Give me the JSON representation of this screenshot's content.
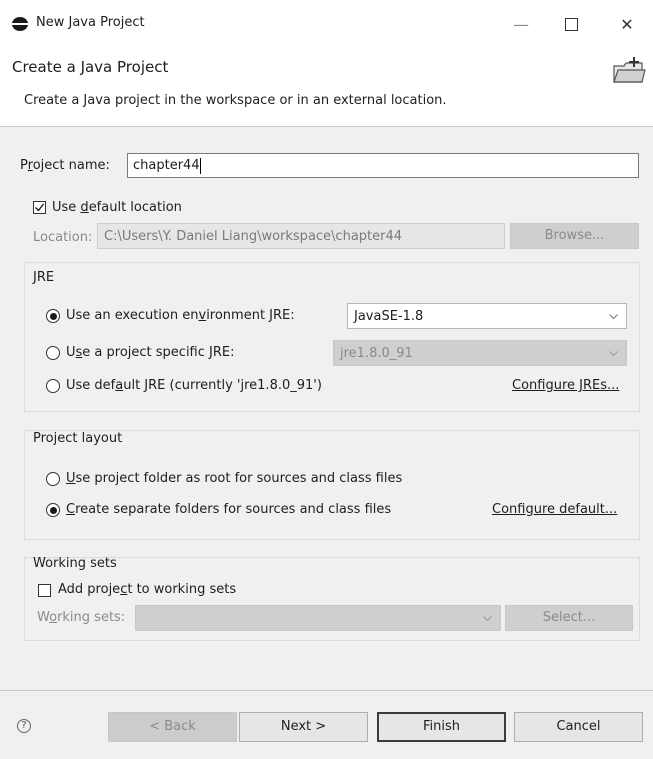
{
  "window": {
    "title": "New Java Project",
    "minimize_glyph": "—",
    "close_glyph": "✕"
  },
  "header": {
    "title": "Create a Java Project",
    "description": "Create a Java project in the workspace or in an external location.",
    "icon": "new-project-folder-icon"
  },
  "project_name": {
    "label_pre": "P",
    "label_mnemonic": "r",
    "label_post": "oject name:",
    "value": "chapter44"
  },
  "location": {
    "default_checkbox_pre": "Use ",
    "default_checkbox_mnemonic": "d",
    "default_checkbox_post": "efault location",
    "default_checked": true,
    "label": "Location:",
    "value": "C:\\Users\\Y. Daniel Liang\\workspace\\chapter44",
    "browse_label": "Browse..."
  },
  "jre": {
    "group_label": "JRE",
    "option1_pre": "Use an execution en",
    "option1_mnemonic": "v",
    "option1_post": "ironment JRE:",
    "option1_selected": true,
    "env_select_value": "JavaSE-1.8",
    "option2_pre": "U",
    "option2_mnemonic": "s",
    "option2_post": "e a project specific JRE:",
    "option2_selected": false,
    "jre_select_value": "jre1.8.0_91",
    "option3_pre": "Use def",
    "option3_mnemonic": "a",
    "option3_post": "ult JRE (currently 'jre1.8.0_91')",
    "option3_selected": false,
    "configure_link": "Configure JREs..."
  },
  "layout": {
    "group_label": "Project layout",
    "option1_pre": "",
    "option1_mnemonic": "U",
    "option1_post": "se project folder as root for sources and class files",
    "option1_selected": false,
    "option2_pre": "",
    "option2_mnemonic": "C",
    "option2_post": "reate separate folders for sources and class files",
    "option2_selected": true,
    "configure_link": "Configure default..."
  },
  "working_sets": {
    "group_label": "Working sets",
    "checkbox_pre": "Add proje",
    "checkbox_mnemonic": "c",
    "checkbox_post": "t to working sets",
    "checked": false,
    "label_pre": "W",
    "label_mnemonic": "o",
    "label_post": "rking sets:",
    "select_value": "",
    "select_button": "Select..."
  },
  "footer": {
    "help_icon": "help-icon",
    "help_glyph": "?",
    "back_label": "< Back",
    "next_label": "Next >",
    "finish_label": "Finish",
    "cancel_label": "Cancel"
  },
  "colors": {
    "dialog_bg": "#f0f0f0",
    "header_bg": "#ffffff",
    "disabled_bg": "#cfcfcf"
  }
}
